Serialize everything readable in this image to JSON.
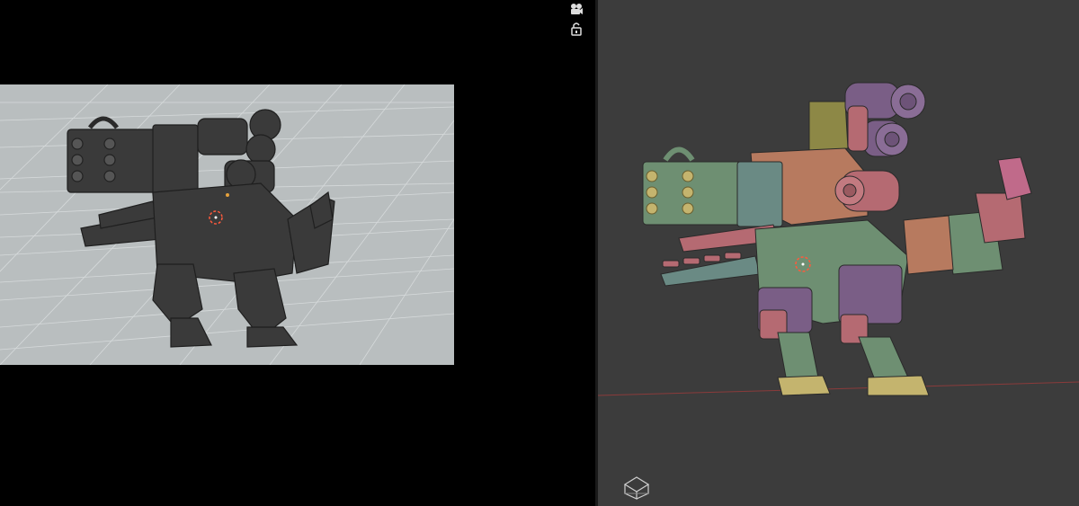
{
  "viewports": {
    "left": {
      "kind": "camera-view",
      "background": "#000000",
      "frame_color": "#b9bebf",
      "model_color": "#3a3a3a"
    },
    "right": {
      "kind": "solid-view",
      "background": "#3c3c3c"
    }
  },
  "icons": {
    "camera": "camera-icon",
    "lock": "lock-icon",
    "view_cube": "view-cube-icon",
    "pivot_left": "pivot-icon",
    "pivot_right": "pivot-icon"
  },
  "model_part_colors": {
    "green": "#6e8f72",
    "rose": "#b56a72",
    "orange": "#b77a5f",
    "purple": "#7a5e86",
    "olive": "#8d8846",
    "yellow": "#c4b46e",
    "pink": "#c06a8a",
    "gray_teal": "#6a8a84"
  },
  "accent_colors": {
    "pivot": "#ff5a3c",
    "axis_line": "#8a3b3b"
  }
}
